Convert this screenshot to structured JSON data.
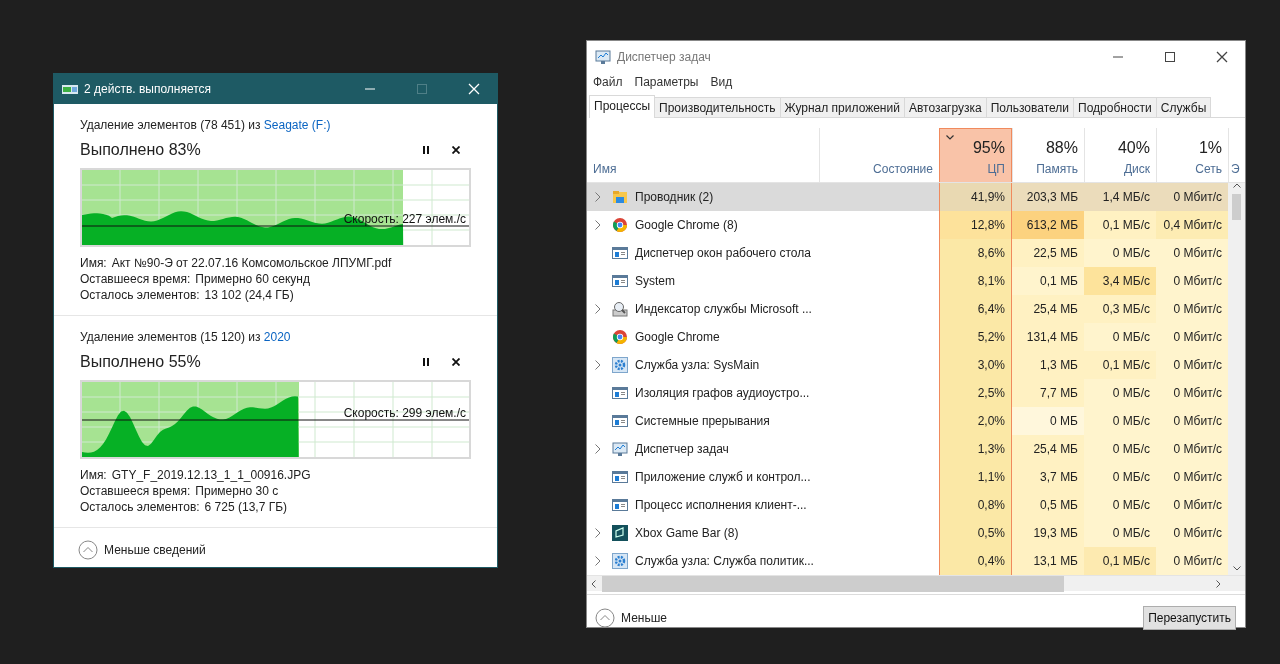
{
  "copy_dialog": {
    "title": "2 действ. выполняется",
    "operations": [
      {
        "heading": "Удаление элементов (78 451) из ",
        "source_link": "Seagate (F:)",
        "progress_text": "Выполнено 83%",
        "level": 0.83,
        "speed": "Скорость: 227 элем./с",
        "details": [
          {
            "label": "Имя:",
            "value": "Акт №90-Э от 22.07.16 Комсомольское ЛПУМГ.pdf"
          },
          {
            "label": "Оставшееся время:",
            "value": "Примерно 60 секунд"
          },
          {
            "label": "Осталось элементов:",
            "value": "13 102 (24,4 ГБ)"
          }
        ]
      },
      {
        "heading": "Удаление элементов (15 120) из ",
        "source_link": "2020",
        "progress_text": "Выполнено 55%",
        "level": 0.56,
        "speed": "Скорость: 299 элем./с",
        "details": [
          {
            "label": "Имя:",
            "value": "GTY_F_2019.12.13_1_1_00916.JPG"
          },
          {
            "label": "Оставшееся время:",
            "value": "Примерно 30 с"
          },
          {
            "label": "Осталось элементов:",
            "value": "6 725 (13,7 ГБ)"
          }
        ]
      }
    ],
    "toggle": "Меньше сведений"
  },
  "task_manager": {
    "title": "Диспетчер задач",
    "menu": [
      "Файл",
      "Параметры",
      "Вид"
    ],
    "tabs": [
      {
        "label": "Процессы",
        "selected": true
      },
      {
        "label": "Производительность",
        "selected": false
      },
      {
        "label": "Журнал приложений",
        "selected": false
      },
      {
        "label": "Автозагрузка",
        "selected": false
      },
      {
        "label": "Пользователи",
        "selected": false
      },
      {
        "label": "Подробности",
        "selected": false
      },
      {
        "label": "Службы",
        "selected": false
      }
    ],
    "columns": [
      {
        "label": "Имя",
        "sorted": false
      },
      {
        "label": "Состояние",
        "sorted": false
      },
      {
        "percent": "95%",
        "label": "ЦП",
        "sorted": true
      },
      {
        "percent": "88%",
        "label": "Память",
        "sorted": false
      },
      {
        "percent": "40%",
        "label": "Диск",
        "sorted": false
      },
      {
        "percent": "1%",
        "label": "Сеть",
        "sorted": false
      },
      {
        "label": "Э",
        "sorted": false
      }
    ],
    "rows": [
      {
        "kind": "folder",
        "expandable": true,
        "selected": true,
        "cells": [
          {
            "text": "Проводник (2)"
          },
          {
            "text": ""
          },
          {
            "text": "41,9%",
            "color": "#e9d9b2"
          },
          {
            "text": "203,3 МБ",
            "color": "#ebdcbb"
          },
          {
            "text": "1,4 МБ/с",
            "color": "#ebdcbb"
          },
          {
            "text": "0 Мбит/с",
            "color": "#ebdcbb"
          }
        ]
      },
      {
        "kind": "browser",
        "expandable": true,
        "selected": false,
        "cells": [
          {
            "text": "Google Chrome (8)"
          },
          {
            "text": ""
          },
          {
            "text": "12,8%",
            "color": "#fde29b"
          },
          {
            "text": "613,2 МБ",
            "color": "#fcd27f"
          },
          {
            "text": "0,1 МБ/с",
            "color": "#fff1c2"
          },
          {
            "text": "0,4 Мбит/с",
            "color": "#fdecb3"
          }
        ]
      },
      {
        "kind": "window",
        "expandable": false,
        "selected": false,
        "cells": [
          {
            "text": "Диспетчер окон рабочего стола"
          },
          {
            "text": ""
          },
          {
            "text": "8,6%",
            "color": "#fbe8a6"
          },
          {
            "text": "22,5 МБ",
            "color": "#fff1c2"
          },
          {
            "text": "0 МБ/с",
            "color": "#fff4cd"
          },
          {
            "text": "0 Мбит/с",
            "color": "#fff4cd"
          }
        ]
      },
      {
        "kind": "window",
        "expandable": false,
        "selected": false,
        "cells": [
          {
            "text": "System"
          },
          {
            "text": ""
          },
          {
            "text": "8,1%",
            "color": "#fbe8a6"
          },
          {
            "text": "0,1 МБ",
            "color": "#fff4cd"
          },
          {
            "text": "3,4 МБ/с",
            "color": "#fde39b"
          },
          {
            "text": "0 Мбит/с",
            "color": "#fff4cd"
          }
        ]
      },
      {
        "kind": "indexer",
        "expandable": true,
        "selected": false,
        "cells": [
          {
            "text": "Индексатор службы Microsoft ..."
          },
          {
            "text": ""
          },
          {
            "text": "6,4%",
            "color": "#fbe8a6"
          },
          {
            "text": "25,4 МБ",
            "color": "#fff1c2"
          },
          {
            "text": "0,3 МБ/с",
            "color": "#fff1c2"
          },
          {
            "text": "0 Мбит/с",
            "color": "#fff4cd"
          }
        ]
      },
      {
        "kind": "browser",
        "expandable": false,
        "selected": false,
        "cells": [
          {
            "text": "Google Chrome"
          },
          {
            "text": ""
          },
          {
            "text": "5,2%",
            "color": "#fbe8a6"
          },
          {
            "text": "131,4 МБ",
            "color": "#fff1c2"
          },
          {
            "text": "0 МБ/с",
            "color": "#fff4cd"
          },
          {
            "text": "0 Мбит/с",
            "color": "#fff4cd"
          }
        ]
      },
      {
        "kind": "gear",
        "expandable": true,
        "selected": false,
        "cells": [
          {
            "text": "Служба узла: SysMain"
          },
          {
            "text": ""
          },
          {
            "text": "3,0%",
            "color": "#fbe8a6"
          },
          {
            "text": "1,3 МБ",
            "color": "#fff1c2"
          },
          {
            "text": "0,1 МБ/с",
            "color": "#fff1c2"
          },
          {
            "text": "0 Мбит/с",
            "color": "#fff4cd"
          }
        ]
      },
      {
        "kind": "window",
        "expandable": false,
        "selected": false,
        "cells": [
          {
            "text": "Изоляция графов аудиоустро..."
          },
          {
            "text": ""
          },
          {
            "text": "2,5%",
            "color": "#fbe8a6"
          },
          {
            "text": "7,7 МБ",
            "color": "#fff1c2"
          },
          {
            "text": "0 МБ/с",
            "color": "#fff4cd"
          },
          {
            "text": "0 Мбит/с",
            "color": "#fff4cd"
          }
        ]
      },
      {
        "kind": "window",
        "expandable": false,
        "selected": false,
        "cells": [
          {
            "text": "Системные прерывания"
          },
          {
            "text": ""
          },
          {
            "text": "2,0%",
            "color": "#fbe8a6"
          },
          {
            "text": "0 МБ",
            "color": "#fff7dc"
          },
          {
            "text": "0 МБ/с",
            "color": "#fff4cd"
          },
          {
            "text": "0 Мбит/с",
            "color": "#fff4cd"
          }
        ]
      },
      {
        "kind": "monitor",
        "expandable": true,
        "selected": false,
        "cells": [
          {
            "text": "Диспетчер задач"
          },
          {
            "text": ""
          },
          {
            "text": "1,3%",
            "color": "#fbe8a6"
          },
          {
            "text": "25,4 МБ",
            "color": "#fff1c2"
          },
          {
            "text": "0 МБ/с",
            "color": "#fff4cd"
          },
          {
            "text": "0 Мбит/с",
            "color": "#fff4cd"
          }
        ]
      },
      {
        "kind": "window",
        "expandable": false,
        "selected": false,
        "cells": [
          {
            "text": "Приложение служб и контрол..."
          },
          {
            "text": ""
          },
          {
            "text": "1,1%",
            "color": "#fbe8a6"
          },
          {
            "text": "3,7 МБ",
            "color": "#fff1c2"
          },
          {
            "text": "0 МБ/с",
            "color": "#fff4cd"
          },
          {
            "text": "0 Мбит/с",
            "color": "#fff4cd"
          }
        ]
      },
      {
        "kind": "window",
        "expandable": false,
        "selected": false,
        "cells": [
          {
            "text": "Процесс исполнения клиент-..."
          },
          {
            "text": ""
          },
          {
            "text": "0,8%",
            "color": "#fbe8a6"
          },
          {
            "text": "0,5 МБ",
            "color": "#fff1c2"
          },
          {
            "text": "0 МБ/с",
            "color": "#fff4cd"
          },
          {
            "text": "0 Мбит/с",
            "color": "#fff4cd"
          }
        ]
      },
      {
        "kind": "tile",
        "expandable": true,
        "selected": false,
        "cells": [
          {
            "text": "Xbox Game Bar (8)"
          },
          {
            "text": ""
          },
          {
            "text": "0,5%",
            "color": "#fbe8a6"
          },
          {
            "text": "19,3 МБ",
            "color": "#fff1c2"
          },
          {
            "text": "0 МБ/с",
            "color": "#fff4cd"
          },
          {
            "text": "0 Мбит/с",
            "color": "#fff4cd"
          }
        ]
      },
      {
        "kind": "gear",
        "expandable": true,
        "selected": false,
        "cells": [
          {
            "text": "Служба узла: Служба политик..."
          },
          {
            "text": ""
          },
          {
            "text": "0,4%",
            "color": "#fbe8a6"
          },
          {
            "text": "13,1 МБ",
            "color": "#fff1c2"
          },
          {
            "text": "0,1 МБ/с",
            "color": "#fdeab0"
          },
          {
            "text": "0 Мбит/с",
            "color": "#fff4cd"
          }
        ]
      }
    ],
    "toggle": "Меньше",
    "restart_button": "Перезапустить"
  }
}
